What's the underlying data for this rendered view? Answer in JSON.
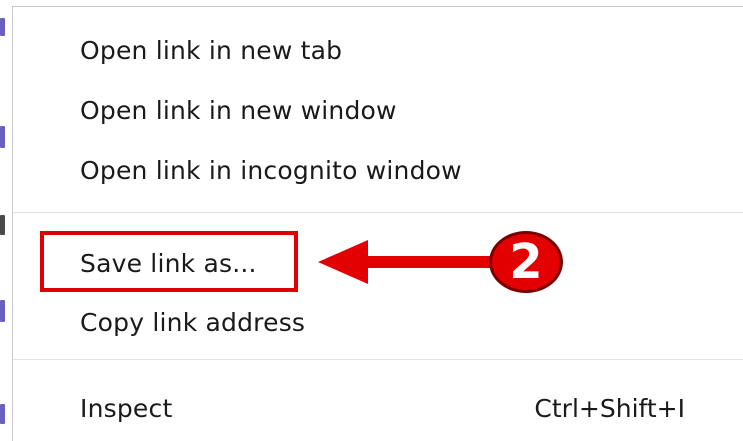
{
  "context_menu": {
    "items": [
      {
        "label": "Open link in new tab"
      },
      {
        "label": "Open link in new window"
      },
      {
        "label": "Open link in incognito window"
      },
      {
        "label": "Save link as..."
      },
      {
        "label": "Copy link address"
      },
      {
        "label": "Inspect",
        "shortcut": "Ctrl+Shift+I"
      }
    ]
  },
  "annotation": {
    "step_number": "2",
    "highlight_color": "#e00000",
    "arrow_icon": "arrow-left-icon",
    "badge_icon": "step-number-badge"
  }
}
